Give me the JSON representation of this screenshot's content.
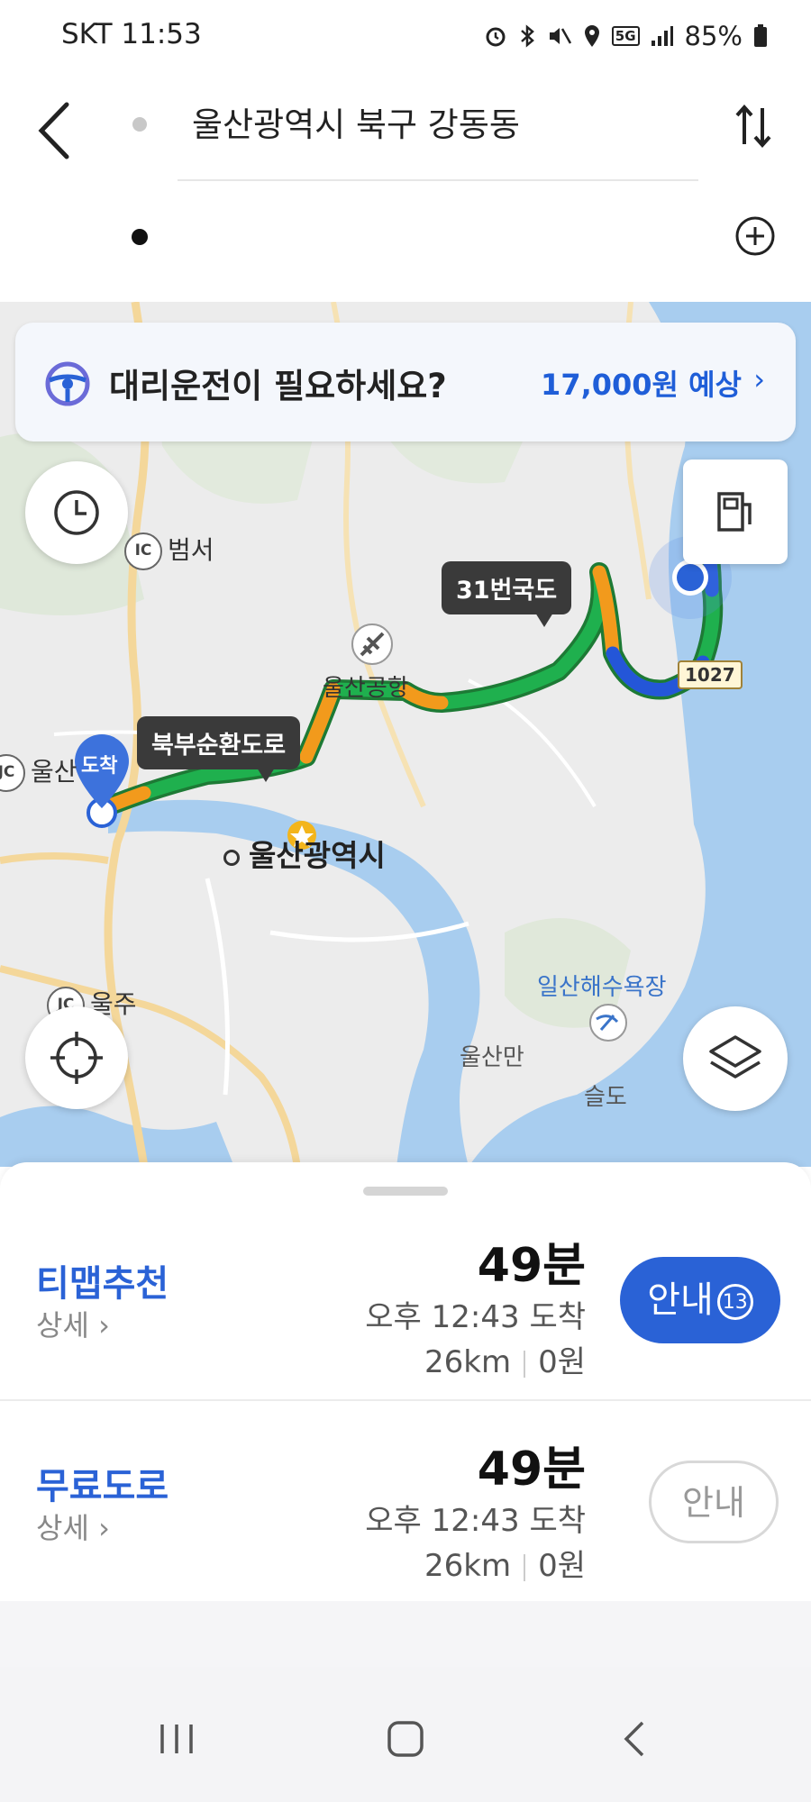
{
  "status_bar": {
    "carrier": "SKT",
    "time": "11:53",
    "network": "5G",
    "battery": "85%"
  },
  "search": {
    "origin": "울산광역시 북구 강동동",
    "destination_value": "",
    "destination_placeholder": ""
  },
  "banner": {
    "text": "대리운전이 필요하세요?",
    "price": "17,000원 예상",
    "chevron": "›"
  },
  "map": {
    "labels": {
      "beomseo": "범서",
      "ic": "IC",
      "jc": "JC",
      "airport": "울산공항",
      "ulsan_left": "울산",
      "city": "울산광역시",
      "ulju": "울주",
      "beach": "일산해수욕장",
      "bay": "울산만",
      "island": "슬도"
    },
    "tags": {
      "route31": "31번국도",
      "bukbu": "북부순환도로",
      "arrival": "도착"
    },
    "shield": "1027"
  },
  "routes": [
    {
      "name": "티맵추천",
      "detail": "상세",
      "duration": "49분",
      "arrival": "오후 12:43 도착",
      "distance": "26km",
      "toll": "0원",
      "guide_label": "안내",
      "guide_count": "13"
    },
    {
      "name": "무료도로",
      "detail": "상세",
      "duration": "49분",
      "arrival": "오후 12:43 도착",
      "distance": "26km",
      "toll": "0원",
      "guide_label": "안내"
    }
  ],
  "icons": {
    "back": "back-arrow-icon",
    "swap": "swap-icon",
    "add": "add-waypoint-icon",
    "steering": "steering-wheel-icon",
    "history": "clock-icon",
    "gas": "gas-station-icon",
    "locate": "crosshair-icon",
    "layers": "layers-icon"
  },
  "colors": {
    "accent": "#2a62d6",
    "route_green": "#1fb04e",
    "route_orange": "#f29a1c",
    "route_blue": "#2456d8",
    "water": "#a8cdef"
  }
}
